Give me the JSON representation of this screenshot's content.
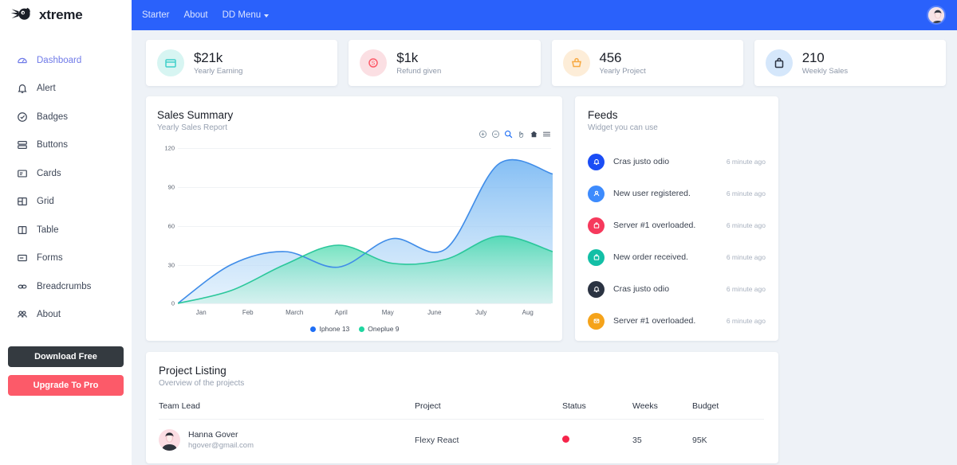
{
  "brand": {
    "name": "xtreme",
    "logo_icon": "rocket-logo-icon"
  },
  "sidebar": {
    "items": [
      {
        "label": "Dashboard",
        "icon": "speedometer-icon",
        "active": true
      },
      {
        "label": "Alert",
        "icon": "bell-icon",
        "active": false
      },
      {
        "label": "Badges",
        "icon": "check-circle-icon",
        "active": false
      },
      {
        "label": "Buttons",
        "icon": "stack-icon",
        "active": false
      },
      {
        "label": "Cards",
        "icon": "card-icon",
        "active": false
      },
      {
        "label": "Grid",
        "icon": "grid-icon",
        "active": false
      },
      {
        "label": "Table",
        "icon": "table-icon",
        "active": false
      },
      {
        "label": "Forms",
        "icon": "form-icon",
        "active": false
      },
      {
        "label": "Breadcrumbs",
        "icon": "link-icon",
        "active": false
      },
      {
        "label": "About",
        "icon": "users-icon",
        "active": false
      }
    ],
    "download_label": "Download Free",
    "upgrade_label": "Upgrade To Pro",
    "download_color": "#343a40",
    "upgrade_color": "#fc5a69",
    "active_color": "#6f7ae8"
  },
  "topbar": {
    "background": "#2a61fb",
    "links": [
      {
        "label": "Starter",
        "has_caret": false
      },
      {
        "label": "About",
        "has_caret": false
      },
      {
        "label": "DD Menu",
        "has_caret": true
      }
    ],
    "avatar_icon": "user-avatar-icon"
  },
  "stats": [
    {
      "value": "$21k",
      "label": "Yearly Earning",
      "icon": "wallet-icon",
      "bg": "#d7f5f2",
      "fg": "#3fd0c9"
    },
    {
      "value": "$1k",
      "label": "Refund given",
      "icon": "dollar-icon",
      "bg": "#fbdfe3",
      "fg": "#fc5a69"
    },
    {
      "value": "456",
      "label": "Yearly Project",
      "icon": "basket-icon",
      "bg": "#fdedd8",
      "fg": "#f7a942"
    },
    {
      "value": "210",
      "label": "Weekly Sales",
      "icon": "briefcase-icon",
      "bg": "#d5e7fb",
      "fg": "#2b3342"
    }
  ],
  "sales_summary": {
    "title": "Sales Summary",
    "subtitle": "Yearly Sales Report",
    "toolbar": [
      {
        "name": "zoom-in-icon",
        "active": false
      },
      {
        "name": "zoom-out-icon",
        "active": false
      },
      {
        "name": "selection-icon",
        "active": true
      },
      {
        "name": "pan-icon",
        "active": false
      },
      {
        "name": "reset-home-icon",
        "active": false
      },
      {
        "name": "menu-icon",
        "active": false
      }
    ]
  },
  "chart_data": {
    "type": "area",
    "title": "Sales Summary",
    "subtitle": "Yearly Sales Report",
    "categories": [
      "Jan",
      "Feb",
      "March",
      "April",
      "May",
      "June",
      "July",
      "Aug"
    ],
    "series": [
      {
        "name": "Iphone 13",
        "color": "#1e6ef5",
        "fill": "#a4cdf7",
        "values": [
          0,
          30,
          40,
          28,
          50,
          42,
          108,
          100
        ]
      },
      {
        "name": "Oneplue 9",
        "color": "#1fd6a0",
        "fill": "#9fe6d2",
        "values": [
          0,
          10,
          30,
          45,
          31,
          34,
          52,
          40
        ]
      }
    ],
    "ylabel": "",
    "xlabel": "",
    "yticks": [
      0,
      30,
      60,
      90,
      120
    ],
    "ylim": [
      0,
      120
    ],
    "grid": true,
    "legend_position": "bottom",
    "curve": "smooth"
  },
  "feeds": {
    "title": "Feeds",
    "subtitle": "Widget you can use",
    "items": [
      {
        "text": "Cras justo odio",
        "time": "6 minute ago",
        "icon": "bell-icon",
        "color": "#1b4df5"
      },
      {
        "text": "New user registered.",
        "time": "6 minute ago",
        "icon": "user-icon",
        "color": "#3d8bfd"
      },
      {
        "text": "Server #1 overloaded.",
        "time": "6 minute ago",
        "icon": "briefcase-icon",
        "color": "#f6395c"
      },
      {
        "text": "New order received.",
        "time": "6 minute ago",
        "icon": "bag-icon",
        "color": "#13bfa6"
      },
      {
        "text": "Cras justo odio",
        "time": "6 minute ago",
        "icon": "bell-icon",
        "color": "#2b3342"
      },
      {
        "text": "Server #1 overloaded.",
        "time": "6 minute ago",
        "icon": "mail-icon",
        "color": "#f5a31a"
      }
    ]
  },
  "project_listing": {
    "title": "Project Listing",
    "subtitle": "Overview of the projects",
    "columns": [
      "Team Lead",
      "Project",
      "Status",
      "Weeks",
      "Budget"
    ],
    "rows": [
      {
        "name": "Hanna Gover",
        "email": "hgover@gmail.com",
        "project": "Flexy React",
        "status_color": "#f6244a",
        "weeks": "35",
        "budget": "95K"
      }
    ]
  }
}
